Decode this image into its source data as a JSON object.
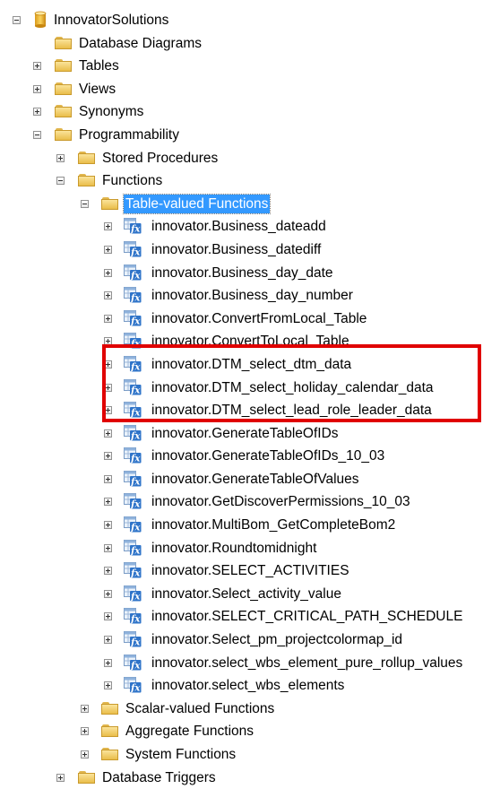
{
  "tree": {
    "root": {
      "label": "InnovatorSolutions",
      "icon": "database-icon",
      "state": "expanded"
    },
    "database_diagrams": {
      "label": "Database Diagrams"
    },
    "tables": {
      "label": "Tables"
    },
    "views": {
      "label": "Views"
    },
    "synonyms": {
      "label": "Synonyms"
    },
    "programmability": {
      "label": "Programmability"
    },
    "stored_procedures": {
      "label": "Stored Procedures"
    },
    "functions": {
      "label": "Functions"
    },
    "table_valued_functions": {
      "label": "Table-valued Functions",
      "selected": true
    },
    "table_valued_items": [
      {
        "label": "innovator.Business_dateadd"
      },
      {
        "label": "innovator.Business_datediff"
      },
      {
        "label": "innovator.Business_day_date"
      },
      {
        "label": "innovator.Business_day_number"
      },
      {
        "label": "innovator.ConvertFromLocal_Table"
      },
      {
        "label": "innovator.ConvertToLocal_Table"
      },
      {
        "label": "innovator.DTM_select_dtm_data"
      },
      {
        "label": "innovator.DTM_select_holiday_calendar_data"
      },
      {
        "label": "innovator.DTM_select_lead_role_leader_data"
      },
      {
        "label": "innovator.GenerateTableOfIDs"
      },
      {
        "label": "innovator.GenerateTableOfIDs_10_03"
      },
      {
        "label": "innovator.GenerateTableOfValues"
      },
      {
        "label": "innovator.GetDiscoverPermissions_10_03"
      },
      {
        "label": "innovator.MultiBom_GetCompleteBom2"
      },
      {
        "label": "innovator.Roundtomidnight"
      },
      {
        "label": "innovator.SELECT_ACTIVITIES"
      },
      {
        "label": "innovator.Select_activity_value"
      },
      {
        "label": "innovator.SELECT_CRITICAL_PATH_SCHEDULE"
      },
      {
        "label": "innovator.Select_pm_projectcolormap_id"
      },
      {
        "label": "innovator.select_wbs_element_pure_rollup_values"
      },
      {
        "label": "innovator.select_wbs_elements"
      }
    ],
    "scalar_valued_functions": {
      "label": "Scalar-valued Functions"
    },
    "aggregate_functions": {
      "label": "Aggregate Functions"
    },
    "system_functions": {
      "label": "System Functions"
    },
    "database_triggers": {
      "label": "Database Triggers"
    }
  },
  "colors": {
    "selection": "#3399ff",
    "highlight_box": "#e00000",
    "folder": "#f2cf6b",
    "function_icon": "#2f74c9"
  }
}
